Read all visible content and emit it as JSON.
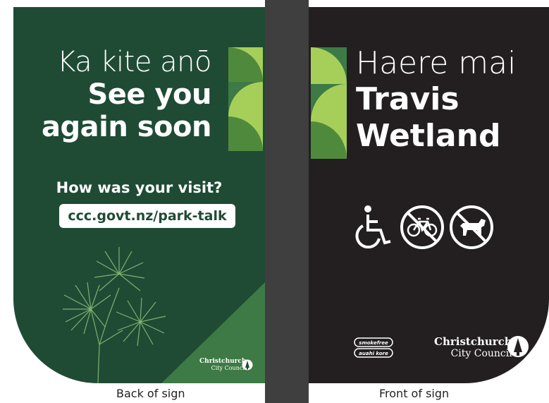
{
  "back_sign": {
    "greeting_light": "Ka kite anō",
    "greeting_bold_1": "See you",
    "greeting_bold_2": "again soon",
    "question": "How was your visit?",
    "url": "ccc.govt.nz/park-talk",
    "logo_name": "Christchurch",
    "logo_sub": "City Council",
    "colors": {
      "background": "#1f4b35",
      "accent_light": "#a6cf5a",
      "accent_dark": "#3d7a45"
    }
  },
  "front_sign": {
    "greeting_light": "Haere mai",
    "greeting_bold_1": "Travis",
    "greeting_bold_2": "Wetland",
    "icons": [
      "wheelchair-access-icon",
      "no-bicycles-icon",
      "no-dogs-icon"
    ],
    "smokefree_top": "smokefree",
    "smokefree_bottom": "auahi kore",
    "logo_name": "Christchurch",
    "logo_sub": "City Council",
    "colors": {
      "background": "#231f20"
    }
  },
  "captions": {
    "back": "Back of sign",
    "front": "Front of sign"
  }
}
